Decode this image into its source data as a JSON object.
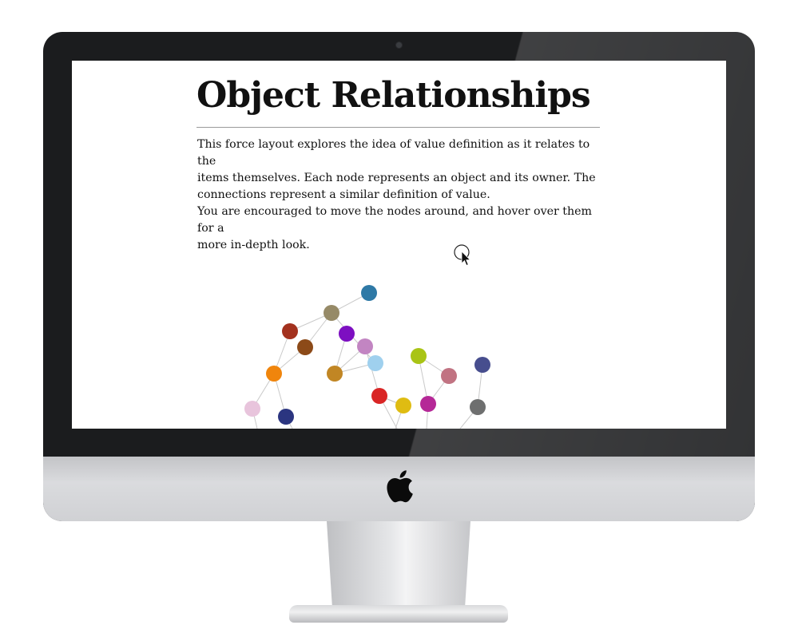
{
  "page": {
    "title": "Object Relationships",
    "intro_lines": [
      "This force layout explores the idea of value definition as it relates to the",
      "items themselves. Each node represents an object and its owner. The",
      "connections represent a similar definition of value.",
      "You are encouraged to move the nodes around, and hover over them for a",
      "more in-depth look."
    ]
  },
  "graph": {
    "nodes": [
      {
        "id": "n1",
        "color": "#2e79a6"
      },
      {
        "id": "n2",
        "color": "#968a67"
      },
      {
        "id": "n3",
        "color": "#a3311e"
      },
      {
        "id": "n4",
        "color": "#7d0fc1"
      },
      {
        "id": "n5",
        "color": "#8c4a18"
      },
      {
        "id": "n6",
        "color": "#c285c2"
      },
      {
        "id": "n7",
        "color": "#f0850c"
      },
      {
        "id": "n8",
        "color": "#c18624"
      },
      {
        "id": "n9",
        "color": "#9fd0ee"
      },
      {
        "id": "n10",
        "color": "#a9c415"
      },
      {
        "id": "n11",
        "color": "#c17382"
      },
      {
        "id": "n12",
        "color": "#474e8e"
      },
      {
        "id": "n13",
        "color": "#d92525"
      },
      {
        "id": "n14",
        "color": "#dfbc12"
      },
      {
        "id": "n15",
        "color": "#b52897"
      },
      {
        "id": "n16",
        "color": "#6e6f6f"
      },
      {
        "id": "n17",
        "color": "#e8c4dc"
      },
      {
        "id": "n18",
        "color": "#2b3580"
      }
    ],
    "links": [
      [
        "n1",
        "n2"
      ],
      [
        "n2",
        "n3"
      ],
      [
        "n2",
        "n5"
      ],
      [
        "n3",
        "n7"
      ],
      [
        "n5",
        "n7"
      ],
      [
        "n2",
        "n9"
      ],
      [
        "n4",
        "n8"
      ],
      [
        "n6",
        "n8"
      ],
      [
        "n8",
        "n9"
      ],
      [
        "n6",
        "n13"
      ],
      [
        "n7",
        "n17"
      ],
      [
        "n7",
        "n18"
      ],
      [
        "n13",
        "n14"
      ],
      [
        "n10",
        "n11"
      ],
      [
        "n11",
        "n15"
      ],
      [
        "n10",
        "n15"
      ],
      [
        "n12",
        "n16"
      ],
      [
        "n13",
        "n14"
      ]
    ]
  },
  "device": {
    "brand_logo": "apple-logo-icon",
    "bezel_color": "#1b1c1e",
    "chin_color": "#d5d6d9"
  }
}
